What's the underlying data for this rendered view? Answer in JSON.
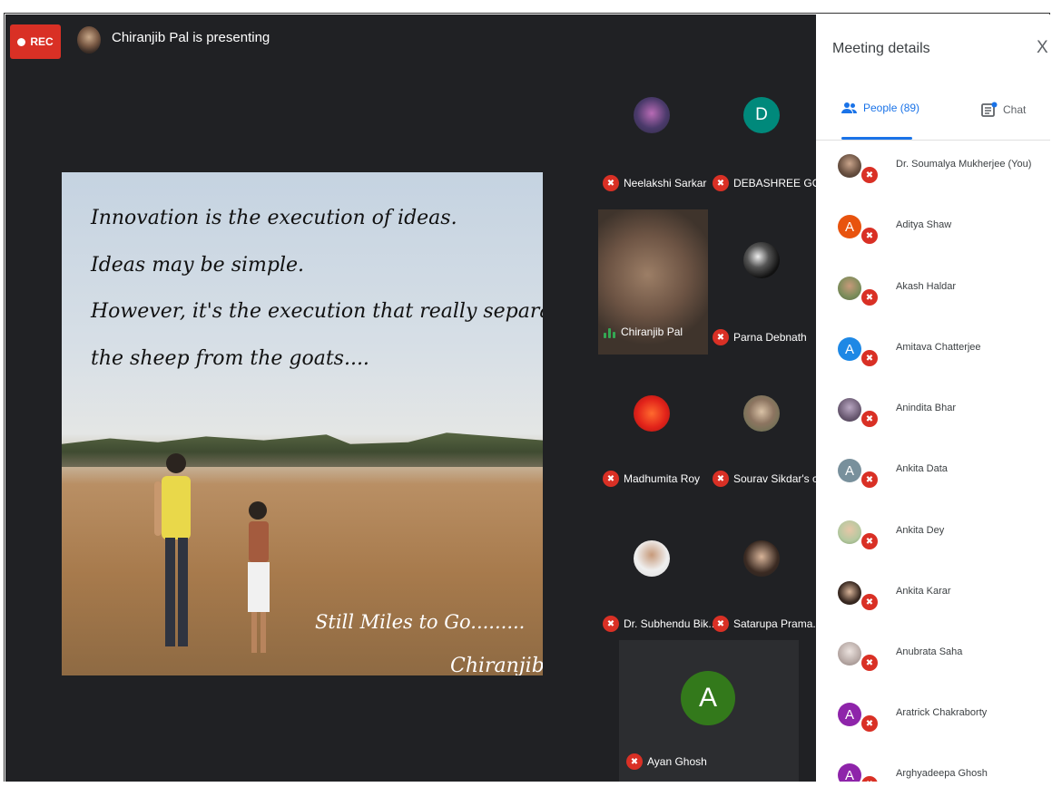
{
  "recording": {
    "label": "REC",
    "color": "#d93025"
  },
  "presenter": {
    "status_text": "Chiranjib Pal is presenting"
  },
  "slide": {
    "quote_lines": [
      "Innovation is the execution of ideas.",
      "Ideas may be simple.",
      "However, it's the execution that really separates",
      "the sheep from the goats...."
    ],
    "caption": "Still Miles to Go.........",
    "signature": "Chiranjib"
  },
  "tiles": [
    {
      "name": "Neelakshi Sarkar",
      "muted": true,
      "avatar_icon": "photo-avatar"
    },
    {
      "name": "DEBASHREE GO...",
      "muted": true,
      "avatar_letter": "D",
      "avatar_color": "#00897b"
    },
    {
      "name": "Chiranjib Pal",
      "muted": false,
      "speaking": true,
      "avatar_icon": "video-feed"
    },
    {
      "name": "Parna Debnath",
      "muted": true,
      "avatar_icon": "photo-avatar"
    },
    {
      "name": "Madhumita Roy",
      "muted": true,
      "avatar_icon": "photo-avatar"
    },
    {
      "name": "Sourav Sikdar's c...",
      "muted": true,
      "avatar_icon": "photo-avatar"
    },
    {
      "name": "Dr. Subhendu Bik...",
      "muted": true,
      "avatar_icon": "photo-avatar"
    },
    {
      "name": "Satarupa Prama...",
      "muted": true,
      "avatar_icon": "photo-avatar"
    },
    {
      "name": "Ayan Ghosh",
      "muted": true,
      "avatar_letter": "A",
      "avatar_color": "#33791b"
    }
  ],
  "panel": {
    "title": "Meeting details",
    "close_icon": "close-icon",
    "tabs": {
      "people": "People (89)",
      "chat": "Chat"
    },
    "accent_color": "#1a73e8",
    "people": [
      {
        "name": "Dr. Soumalya Mukherjee (You)",
        "avatar_color": "#6d5444",
        "avatar_letter": ""
      },
      {
        "name": "Aditya Shaw",
        "avatar_color": "#e8530e",
        "avatar_letter": "A"
      },
      {
        "name": "Akash Haldar",
        "avatar_color": "#7b8c5a",
        "avatar_letter": ""
      },
      {
        "name": "Amitava Chatterjee",
        "avatar_color": "#1e88e5",
        "avatar_letter": "A"
      },
      {
        "name": "Anindita Bhar",
        "avatar_color": "#6a5a72",
        "avatar_letter": ""
      },
      {
        "name": "Ankita Data",
        "avatar_color": "#78909c",
        "avatar_letter": "A"
      },
      {
        "name": "Ankita Dey",
        "avatar_color": "#b5c9a0",
        "avatar_letter": ""
      },
      {
        "name": "Ankita Karar",
        "avatar_color": "#3a2a22",
        "avatar_letter": ""
      },
      {
        "name": "Anubrata Saha",
        "avatar_color": "#b7a9a5",
        "avatar_letter": ""
      },
      {
        "name": "Aratrick Chakraborty",
        "avatar_color": "#8e24aa",
        "avatar_letter": "A"
      },
      {
        "name": "Arghyadeepa Ghosh",
        "avatar_color": "#8e24aa",
        "avatar_letter": "A"
      }
    ]
  }
}
